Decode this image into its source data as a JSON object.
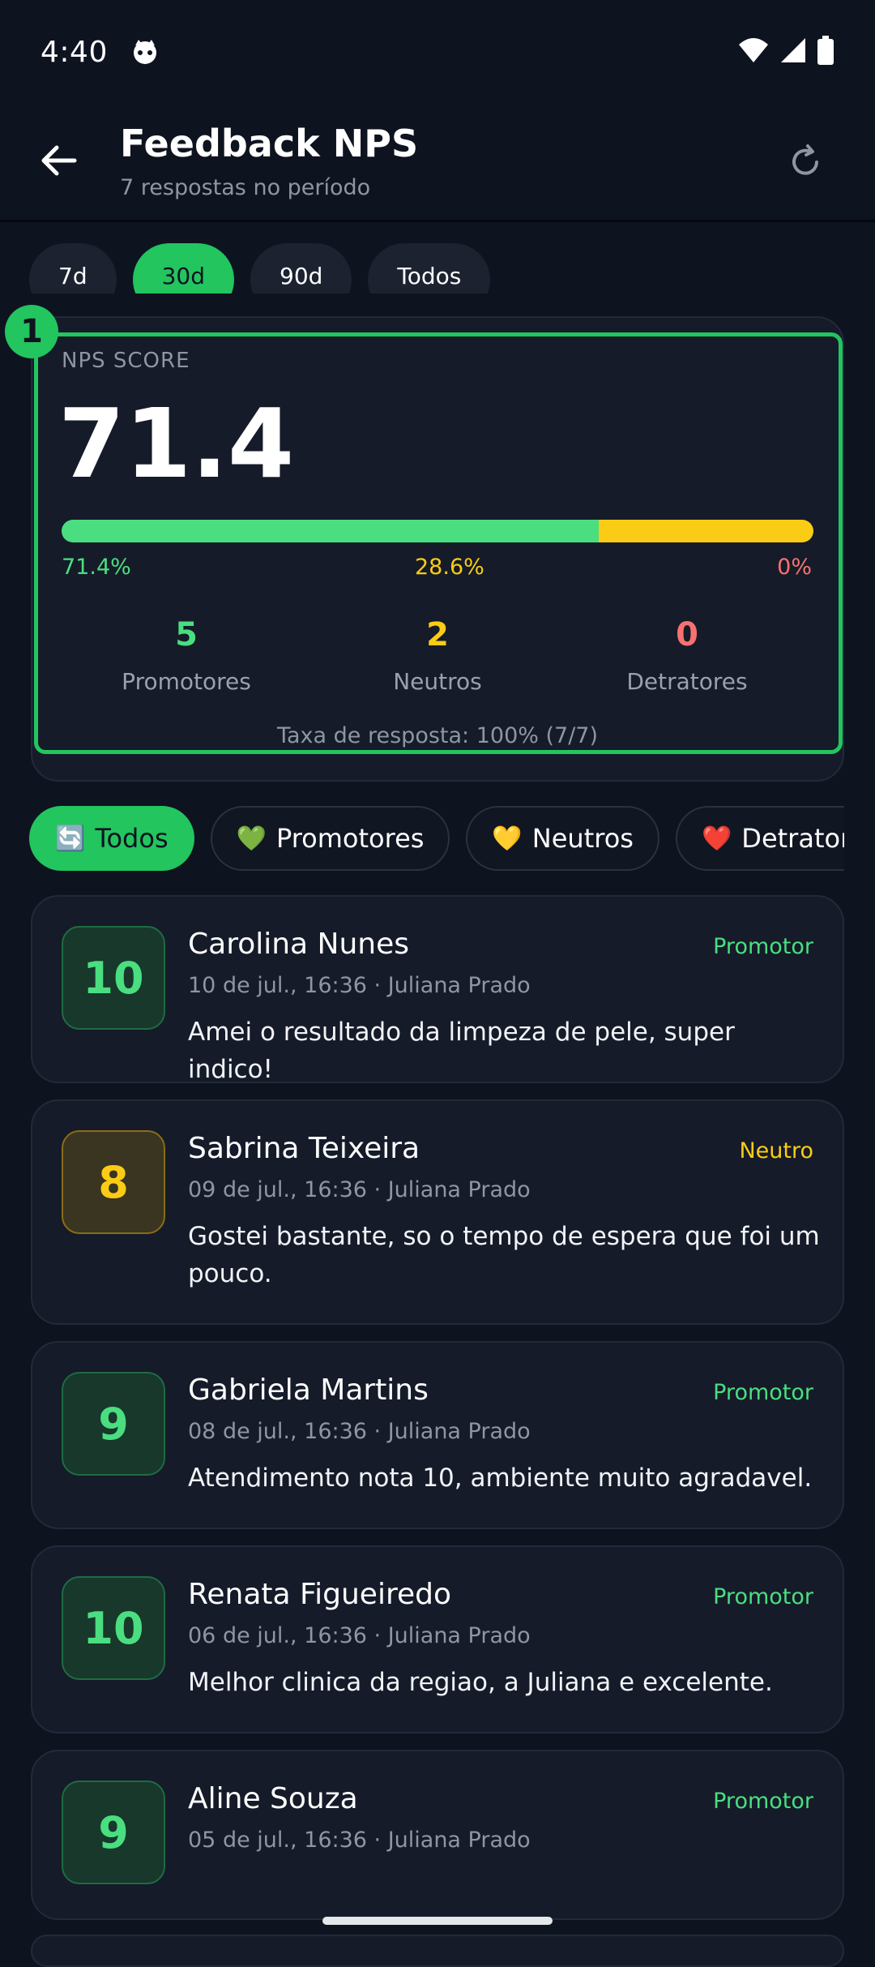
{
  "status_bar": {
    "time": "4:40"
  },
  "header": {
    "title": "Feedback NPS",
    "subtitle": "7 respostas no período"
  },
  "periods": [
    {
      "label": "7d",
      "active": false
    },
    {
      "label": "30d",
      "active": true
    },
    {
      "label": "90d",
      "active": false
    },
    {
      "label": "Todos",
      "active": false
    }
  ],
  "marker": "1",
  "nps": {
    "label": "NPS SCORE",
    "score": "71.4",
    "promoters_pct": "71.4%",
    "neutrals_pct": "28.6%",
    "detractors_pct": "0%",
    "promoters_fraction": 0.714,
    "neutrals_fraction": 0.286,
    "detractors_fraction": 0,
    "promoters_count": "5",
    "promoters_label": "Promotores",
    "neutrals_count": "2",
    "neutrals_label": "Neutros",
    "detractors_count": "0",
    "detractors_label": "Detratores",
    "response_rate": "Taxa de resposta: 100% (7/7)"
  },
  "filters": [
    {
      "emoji": "🔄",
      "label": "Todos",
      "active": true
    },
    {
      "emoji": "💚",
      "label": "Promotores",
      "active": false
    },
    {
      "emoji": "💛",
      "label": "Neutros",
      "active": false
    },
    {
      "emoji": "❤️",
      "label": "Detratores",
      "active": false
    }
  ],
  "feedbacks": [
    {
      "score": "10",
      "name": "Carolina Nunes",
      "tag": "Promotor",
      "meta": "10 de jul., 16:36 · Juliana Prado",
      "comment": "Amei o resultado da limpeza de pele, super indico!"
    },
    {
      "score": "8",
      "name": "Sabrina Teixeira",
      "tag": "Neutro",
      "meta": "09 de jul., 16:36 · Juliana Prado",
      "comment": "Gostei bastante, so o tempo de espera que foi um pouco."
    },
    {
      "score": "9",
      "name": "Gabriela Martins",
      "tag": "Promotor",
      "meta": "08 de jul., 16:36 · Juliana Prado",
      "comment": "Atendimento nota 10, ambiente muito agradavel."
    },
    {
      "score": "10",
      "name": "Renata Figueiredo",
      "tag": "Promotor",
      "meta": "06 de jul., 16:36 · Juliana Prado",
      "comment": "Melhor clinica da regiao, a Juliana e excelente."
    },
    {
      "score": "9",
      "name": "Aline Souza",
      "tag": "Promotor",
      "meta": "05 de jul., 16:36 · Juliana Prado",
      "comment": ""
    }
  ],
  "colors": {
    "promoter": "#4ade80",
    "neutral": "#facc15",
    "detractor": "#f87171",
    "accent": "#22c55e"
  }
}
